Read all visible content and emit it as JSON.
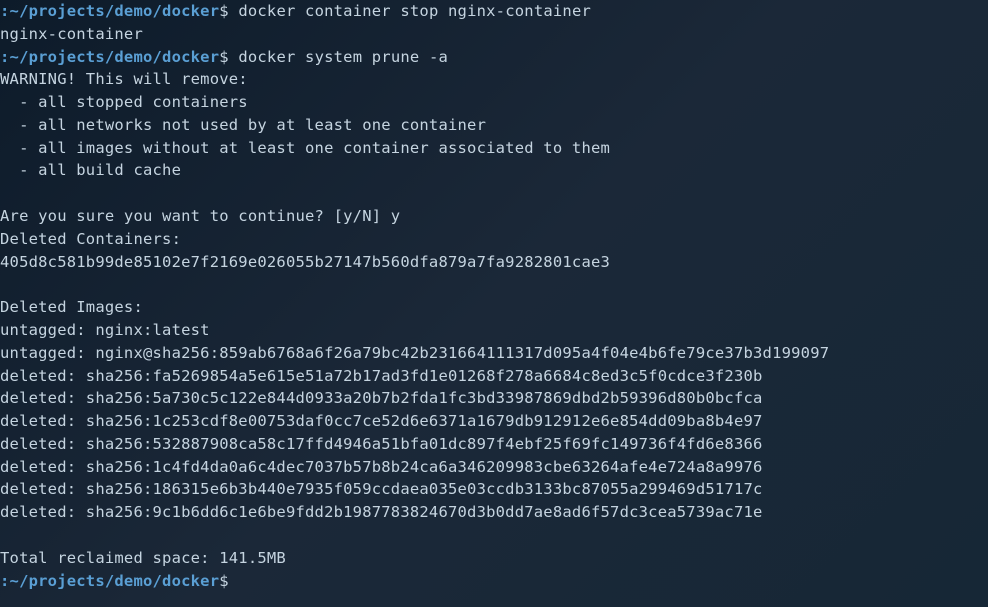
{
  "prompt": {
    "colon": ":",
    "path": "~/projects/demo/docker",
    "dollar": "$"
  },
  "commands": {
    "cmd1": " docker container stop nginx-container",
    "cmd2": " docker system prune -a",
    "cmd3": " "
  },
  "output": {
    "stop_result": "nginx-container",
    "warning_header": "WARNING! This will remove:",
    "warn1": "  - all stopped containers",
    "warn2": "  - all networks not used by at least one container",
    "warn3": "  - all images without at least one container associated to them",
    "warn4": "  - all build cache",
    "blank1": " ",
    "confirm": "Are you sure you want to continue? [y/N] y",
    "deleted_containers_header": "Deleted Containers:",
    "container_hash": "405d8c581b99de85102e7f2169e026055b27147b560dfa879a7fa9282801cae3",
    "blank2": " ",
    "deleted_images_header": "Deleted Images:",
    "untagged1": "untagged: nginx:latest",
    "untagged2": "untagged: nginx@sha256:859ab6768a6f26a79bc42b231664111317d095a4f04e4b6fe79ce37b3d199097",
    "deleted1": "deleted: sha256:fa5269854a5e615e51a72b17ad3fd1e01268f278a6684c8ed3c5f0cdce3f230b",
    "deleted2": "deleted: sha256:5a730c5c122e844d0933a20b7b2fda1fc3bd33987869dbd2b59396d80b0bcfca",
    "deleted3": "deleted: sha256:1c253cdf8e00753daf0cc7ce52d6e6371a1679db912912e6e854dd09ba8b4e97",
    "deleted4": "deleted: sha256:532887908ca58c17ffd4946a51bfa01dc897f4ebf25f69fc149736f4fd6e8366",
    "deleted5": "deleted: sha256:1c4fd4da0a6c4dec7037b57b8b24ca6a346209983cbe63264afe4e724a8a9976",
    "deleted6": "deleted: sha256:186315e6b3b440e7935f059ccdaea035e03ccdb3133bc87055a299469d51717c",
    "deleted7": "deleted: sha256:9c1b6dd6c1e6be9fdd2b1987783824670d3b0dd7ae8ad6f57dc3cea5739ac71e",
    "blank3": " ",
    "reclaimed": "Total reclaimed space: 141.5MB"
  }
}
